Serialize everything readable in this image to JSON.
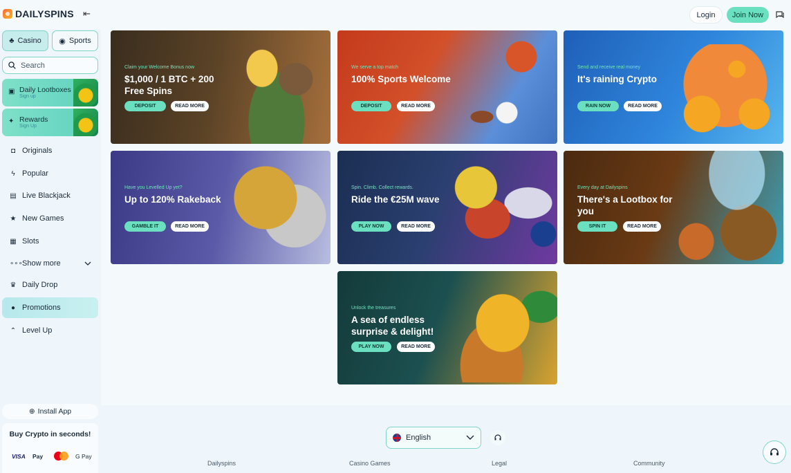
{
  "header": {
    "logo": "DAILYSPINS",
    "login": "Login",
    "join": "Join Now"
  },
  "sidebar": {
    "tabs": [
      {
        "label": "Casino",
        "icon": "cards-icon"
      },
      {
        "label": "Sports",
        "icon": "ball-icon"
      }
    ],
    "search_placeholder": "Search",
    "promo_cards": [
      {
        "title": "Daily Lootboxes",
        "sub": "Sign up"
      },
      {
        "title": "Rewards",
        "sub": "Sign Up"
      }
    ],
    "nav": [
      {
        "label": "Originals",
        "icon": "originals-icon"
      },
      {
        "label": "Popular",
        "icon": "bolt-icon"
      },
      {
        "label": "Live Blackjack",
        "icon": "blackjack-icon"
      },
      {
        "label": "New Games",
        "icon": "star-icon"
      },
      {
        "label": "Slots",
        "icon": "slots-icon"
      },
      {
        "label": "Show more",
        "icon": "dots-icon"
      },
      {
        "label": "Daily Drop",
        "icon": "trophy-icon"
      },
      {
        "label": "Promotions",
        "icon": "moneybag-icon"
      },
      {
        "label": "Level Up",
        "icon": "chevrons-up-icon"
      }
    ],
    "install": "Install App",
    "crypto_title": "Buy Crypto in seconds!",
    "payments": [
      "VISA",
      "Pay",
      "G Pay"
    ]
  },
  "banners": [
    {
      "kicker": "Claim your Welcome Bonus now",
      "headline": "$1,000 / 1 BTC + 200 Free Spins",
      "primary": "DEPOSIT",
      "secondary": "READ MORE"
    },
    {
      "kicker": "We serve a top match",
      "headline": "100% Sports Welcome",
      "primary": "DEPOSIT",
      "secondary": "READ MORE"
    },
    {
      "kicker": "Send and receive real money",
      "headline": "It's raining Crypto",
      "primary": "RAIN NOW",
      "secondary": "READ MORE"
    },
    {
      "kicker": "Have you Levelled Up yet?",
      "headline": "Up to 120% Rakeback",
      "primary": "GAMBLE IT",
      "secondary": "READ MORE"
    },
    {
      "kicker": "Spin. Climb. Collect rewards.",
      "headline": "Ride the €25M wave",
      "primary": "PLAY NOW",
      "secondary": "READ MORE"
    },
    {
      "kicker": "Every day at Dailyspins",
      "headline": "There's a Lootbox for you",
      "primary": "SPIN IT",
      "secondary": "READ MORE"
    },
    {
      "kicker": "Unlock the treasures",
      "headline": "A sea of endless surprise & delight!",
      "primary": "PLAY NOW",
      "secondary": "READ MORE"
    }
  ],
  "footer": {
    "language": "English",
    "columns": [
      "Dailyspins",
      "Casino Games",
      "Legal",
      "Community"
    ]
  }
}
